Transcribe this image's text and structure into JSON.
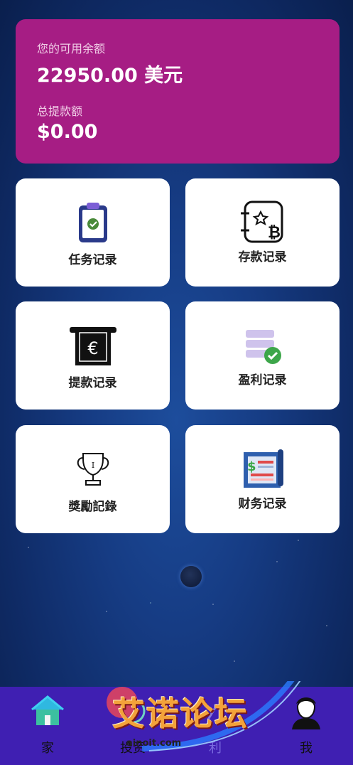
{
  "balance": {
    "available_label": "您的可用余额",
    "available_value": "22950.00 美元",
    "withdrawn_label": "总提款额",
    "withdrawn_value": "$0.00"
  },
  "tiles": [
    {
      "label": "任务记录",
      "icon": "clipboard-check-icon"
    },
    {
      "label": "存款记录",
      "icon": "crypto-deposit-icon"
    },
    {
      "label": "提款记录",
      "icon": "euro-receipt-icon"
    },
    {
      "label": "盈利记录",
      "icon": "database-check-icon"
    },
    {
      "label": "獎勵記錄",
      "icon": "trophy-icon"
    },
    {
      "label": "财务记录",
      "icon": "finance-report-icon"
    }
  ],
  "bottom_nav": [
    {
      "label": "家",
      "icon": "home-icon"
    },
    {
      "label": "投资",
      "icon": "invest-icon"
    },
    {
      "label": "利",
      "icon": "profit-icon"
    },
    {
      "label": "我",
      "icon": "user-avatar-icon"
    }
  ],
  "watermark": {
    "text": "艾诺论坛",
    "sub": "ainoit.com"
  },
  "colors": {
    "card": "#a61d84",
    "nav": "#3f1fb2",
    "tile": "#ffffff",
    "watermark": "#f3a23a"
  }
}
